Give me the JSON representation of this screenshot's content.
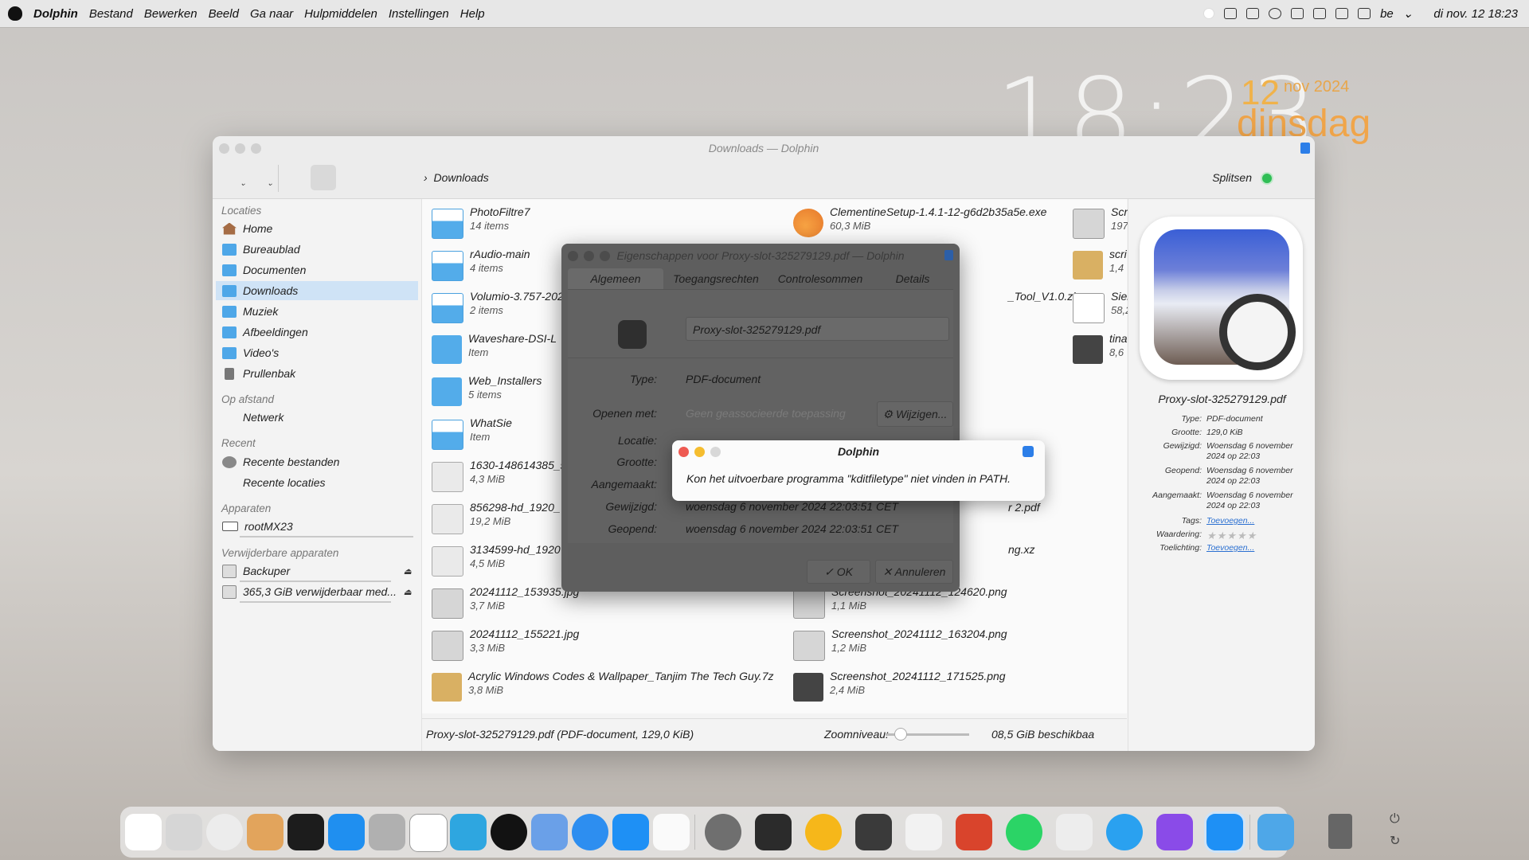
{
  "menubar": {
    "items": [
      "Dolphin",
      "Bestand",
      "Bewerken",
      "Beeld",
      "Ga naar",
      "Hulpmiddelen",
      "Instellingen",
      "Help"
    ],
    "keyboard": "be",
    "datetime": "di  nov. 12  18:23"
  },
  "desktop_clock": {
    "time": "18:23",
    "day": "12",
    "month": "nov 2024",
    "weekday": "dinsdag"
  },
  "window": {
    "title": "Downloads — Dolphin",
    "breadcrumb": "Downloads",
    "split_label": "Splitsen"
  },
  "sidebar": {
    "sections": {
      "places": "Locaties",
      "remote": "Op afstand",
      "recent": "Recent",
      "devices": "Apparaten",
      "removable": "Verwijderbare apparaten"
    },
    "places": [
      "Home",
      "Bureaublad",
      "Documenten",
      "Downloads",
      "Muziek",
      "Afbeeldingen",
      "Video's",
      "Prullenbak"
    ],
    "remote": [
      "Netwerk"
    ],
    "recent": [
      "Recente bestanden",
      "Recente locaties"
    ],
    "devices": [
      "rootMX23"
    ],
    "removable": [
      "Backuper",
      "365,3 GiB verwijderbaar med..."
    ]
  },
  "files": {
    "col1": [
      {
        "name": "PhotoFiltre7",
        "sub": "14 items"
      },
      {
        "name": "rAudio-main",
        "sub": "4 items"
      },
      {
        "name": "Volumio-3.757-202",
        "sub": "2 items"
      },
      {
        "name": "Waveshare-DSI-L",
        "sub": "Item"
      },
      {
        "name": "Web_Installers",
        "sub": "5 items"
      },
      {
        "name": "WhatSie",
        "sub": "Item"
      },
      {
        "name": "1630-148614385_s",
        "sub": "4,3 MiB"
      },
      {
        "name": "856298-hd_1920_",
        "sub": "19,2 MiB"
      },
      {
        "name": "3134599-hd_1920",
        "sub": "4,5 MiB"
      },
      {
        "name": "20241112_153935.jpg",
        "sub": "3,7 MiB"
      },
      {
        "name": "20241112_155221.jpg",
        "sub": "3,3 MiB"
      },
      {
        "name": "Acrylic Windows Codes & Wallpaper_Tanjim The Tech Guy.7z",
        "sub": "3,8 MiB"
      }
    ],
    "col2": [
      {
        "name": "ClementineSetup-1.4.1-12-g6d2b35a5e.exe",
        "sub": "60,3 MiB"
      },
      {
        "name": "_Tool_V1.0.zip",
        "sub": ""
      },
      {
        "name": "r 2.pdf",
        "sub": ""
      },
      {
        "name": "ng.xz",
        "sub": ""
      },
      {
        "name": "Screenshot_20241112_124620.png",
        "sub": "1,1 MiB"
      },
      {
        "name": "Screenshot_20241112_163204.png",
        "sub": "1,2 MiB"
      },
      {
        "name": "Screenshot_20241112_171525.png",
        "sub": "2,4 MiB"
      }
    ],
    "col3": [
      {
        "name": "Scre",
        "sub": "197,"
      },
      {
        "name": "scri",
        "sub": "1,4 "
      },
      {
        "name": "Sier",
        "sub": "58,2"
      },
      {
        "name": "tina",
        "sub": "8,6 "
      }
    ]
  },
  "statusbar": {
    "selection": "Proxy-slot-325279129.pdf (PDF-document, 129,0 KiB)",
    "zoom_label": "Zoomniveau:",
    "zoom_level": 0.12,
    "free_space": "08,5 GiB beschikbaa"
  },
  "info_panel": {
    "filename": "Proxy-slot-325279129.pdf",
    "rows": [
      {
        "k": "Type:",
        "v": "PDF-document"
      },
      {
        "k": "Grootte:",
        "v": "129,0 KiB"
      },
      {
        "k": "Gewijzigd:",
        "v": "Woensdag 6 november 2024 op 22:03"
      },
      {
        "k": "Geopend:",
        "v": "Woensdag 6 november 2024 op 22:03"
      },
      {
        "k": "Aangemaakt:",
        "v": "Woensdag 6 november 2024 op 22:03"
      }
    ],
    "tags_label": "Tags:",
    "tags_link": "Toevoegen...",
    "rating_label": "Waardering:",
    "rating_stars": 0,
    "stars_text": "★★★★★",
    "comment_label": "Toelichting:",
    "comment_link": "Toevoegen..."
  },
  "properties_dialog": {
    "title": "Eigenschappen voor Proxy-slot-325279129.pdf — Dolphin",
    "tabs": [
      "Algemeen",
      "Toegangsrechten",
      "Controlesommen",
      "Details"
    ],
    "filename": "Proxy-slot-325279129.pdf",
    "labels": {
      "type": "Type:",
      "open_with": "Openen met:",
      "location": "Locatie:",
      "size": "Grootte:",
      "created": "Aangemaakt:",
      "modified": "Gewijzigd:",
      "accessed": "Geopend:"
    },
    "type_value": "PDF-document",
    "open_with_value": "Geen geassocieerde toepassing",
    "change_button": "Wijzigen...",
    "modified_value": "woensdag 6 november 2024 22:03:51 CET",
    "accessed_value": "woensdag 6 november 2024 22:03:51 CET",
    "ok_button": "OK",
    "cancel_button": "Annuleren"
  },
  "error_dialog": {
    "title": "Dolphin",
    "message": "Kon het uitvoerbare programma \"kditfiletype\" niet vinden in PATH."
  },
  "colors": {
    "selection": "#cfe3f6",
    "folder": "#53acea",
    "accent_orange": "#f0a54a",
    "link": "#2a6fd1"
  }
}
